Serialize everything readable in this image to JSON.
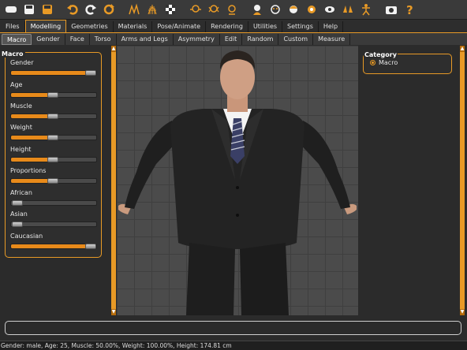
{
  "toolbar": {
    "icons": [
      "undo-redo-file-icon",
      "save-icon",
      "save-as-icon",
      "undo-icon",
      "redo-icon",
      "reset-icon",
      "smooth-icon",
      "wireframe-icon",
      "background-checker-icon",
      "front-view-icon",
      "back-view-icon",
      "left-view-icon",
      "pose-icon",
      "head-icon",
      "face-icon",
      "hair-icon",
      "eyes-icon",
      "hands-icon",
      "skeleton-icon",
      "screenshot-icon",
      "help-icon"
    ]
  },
  "menu": {
    "tabs": [
      "Files",
      "Modelling",
      "Geometries",
      "Materials",
      "Pose/Animate",
      "Rendering",
      "Utilities",
      "Settings",
      "Help"
    ],
    "active": "Modelling"
  },
  "subtabs": {
    "tabs": [
      "Macro",
      "Gender",
      "Face",
      "Torso",
      "Arms and Legs",
      "Asymmetry",
      "Edit",
      "Random",
      "Custom",
      "Measure"
    ],
    "active": "Macro"
  },
  "left_panel": {
    "title": "Macro",
    "sliders": [
      {
        "label": "Gender",
        "value": 1.0
      },
      {
        "label": "Age",
        "value": 0.5
      },
      {
        "label": "Muscle",
        "value": 0.5
      },
      {
        "label": "Weight",
        "value": 0.5
      },
      {
        "label": "Height",
        "value": 0.5
      },
      {
        "label": "Proportions",
        "value": 0.5
      },
      {
        "label": "African",
        "value": 0.0
      },
      {
        "label": "Asian",
        "value": 0.0
      },
      {
        "label": "Caucasian",
        "value": 1.0
      }
    ]
  },
  "right_panel": {
    "title": "Category",
    "option": "Macro"
  },
  "status": {
    "text": "Gender: male, Age: 25, Muscle: 50.00%, Weight: 100.00%, Height: 174.81 cm"
  },
  "colors": {
    "accent": "#e89a26",
    "slider_fill": "#e88a1a",
    "background": "#2b2b2b"
  }
}
